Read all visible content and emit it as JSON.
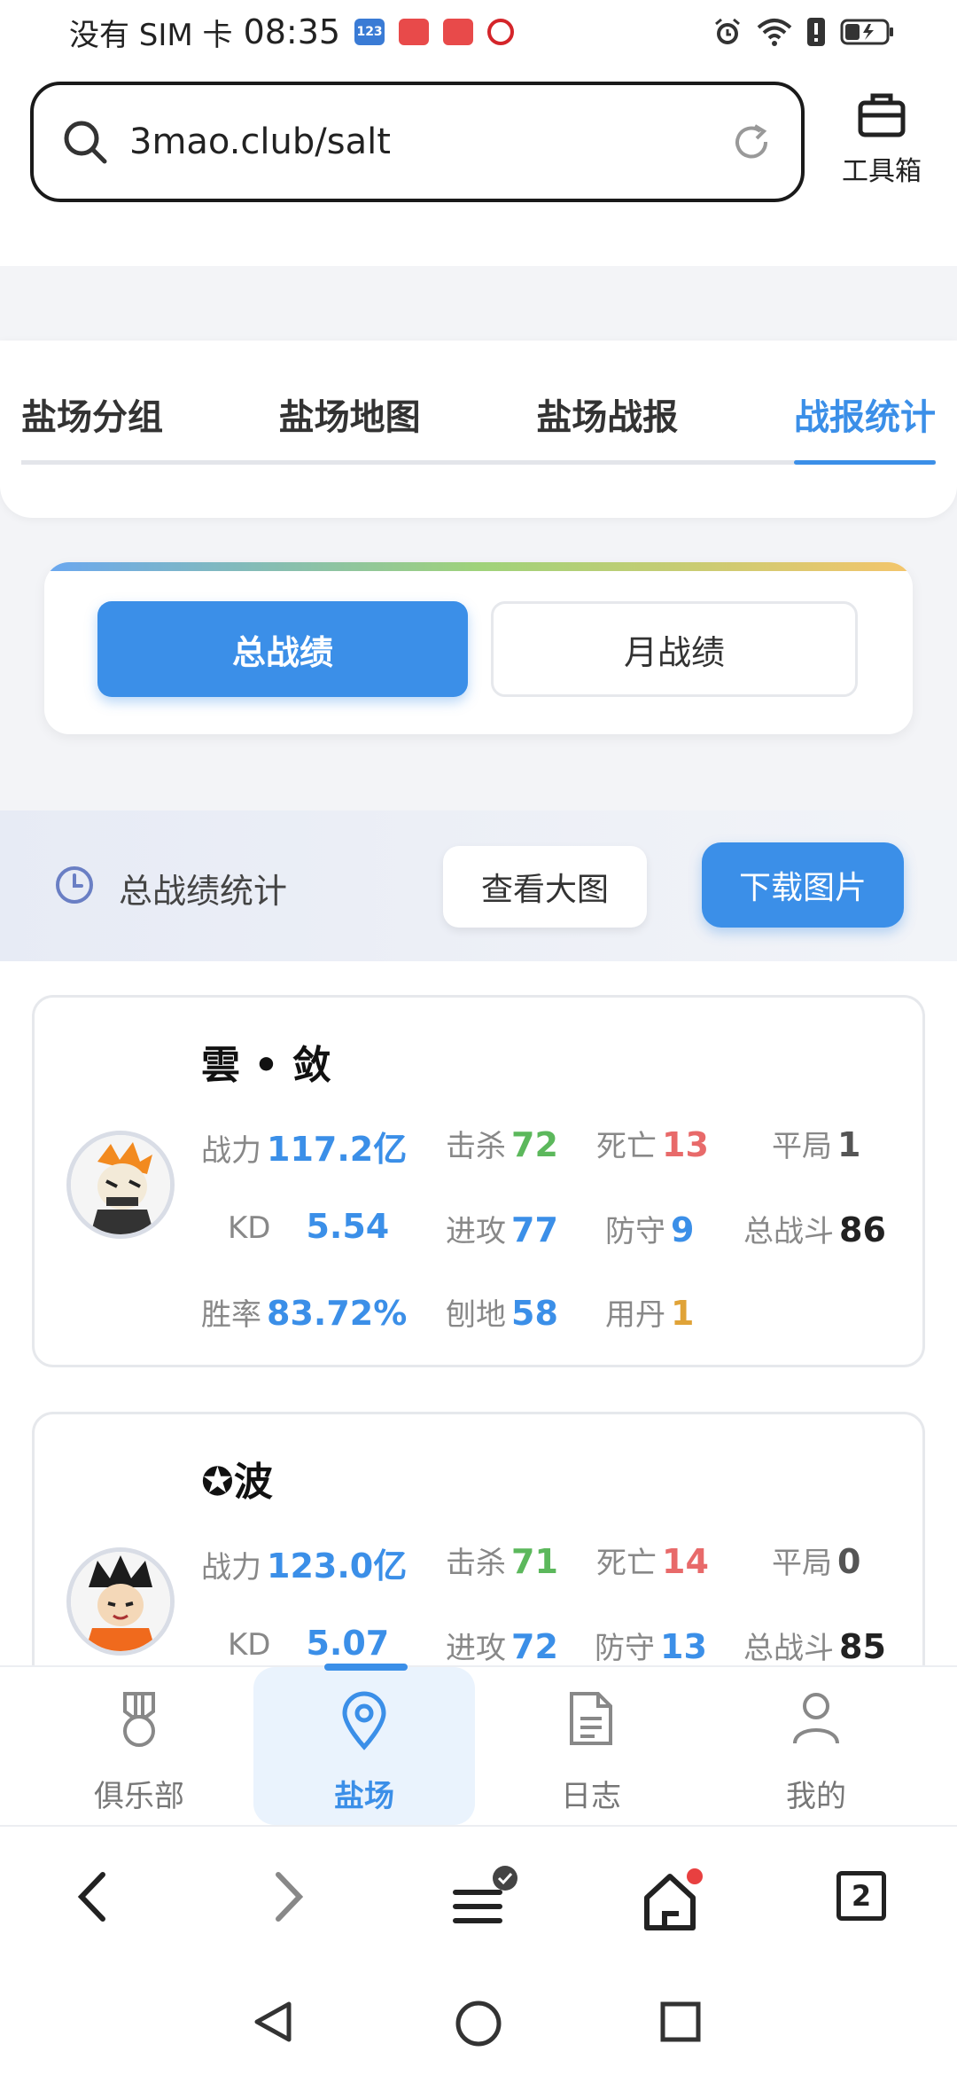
{
  "status_bar": {
    "carrier": "没有 SIM 卡",
    "time": "08:35",
    "badges": [
      {
        "name": "123-app-icon",
        "text": "123",
        "color": "#3a7bd5"
      },
      {
        "name": "huawei-app-icon",
        "text": "",
        "color": "#e84a4a"
      },
      {
        "name": "huawei-store-icon",
        "text": "",
        "color": "#e84a4a"
      },
      {
        "name": "bank-app-icon",
        "text": "",
        "color": "#d4252a"
      }
    ]
  },
  "browser": {
    "url": "3mao.club/salt",
    "toolbox_label": "工具箱"
  },
  "tabs": [
    {
      "label": "盐场分组",
      "active": false
    },
    {
      "label": "盐场地图",
      "active": false
    },
    {
      "label": "盐场战报",
      "active": false
    },
    {
      "label": "战报统计",
      "active": true
    }
  ],
  "toggle": {
    "total": "总战绩",
    "monthly": "月战绩"
  },
  "section": {
    "title": "总战绩统计",
    "view_large": "查看大图",
    "download": "下载图片"
  },
  "labels": {
    "power": "战力",
    "kills": "击杀",
    "deaths": "死亡",
    "draws": "平局",
    "kd": "KD",
    "attack": "进攻",
    "defense": "防守",
    "total_battles": "总战斗",
    "win_rate": "胜率",
    "dig": "刨地",
    "pills": "用丹"
  },
  "players": [
    {
      "name": "雲 • 敛",
      "power": "117.2亿",
      "kills": "72",
      "deaths": "13",
      "draws": "1",
      "kd": "5.54",
      "attack": "77",
      "defense": "9",
      "total_battles": "86",
      "win_rate": "83.72%",
      "dig": "58",
      "pills": "1"
    },
    {
      "name": "✪波",
      "power": "123.0亿",
      "kills": "71",
      "deaths": "14",
      "draws": "0",
      "kd": "5.07",
      "attack": "72",
      "defense": "13",
      "total_battles": "85"
    }
  ],
  "bottom_nav": [
    {
      "label": "俱乐部",
      "icon": "medal-icon",
      "active": false
    },
    {
      "label": "盐场",
      "icon": "location-pin-icon",
      "active": true
    },
    {
      "label": "日志",
      "icon": "document-icon",
      "active": false
    },
    {
      "label": "我的",
      "icon": "user-icon",
      "active": false
    }
  ],
  "browser_nav": {
    "tab_count": "2"
  }
}
